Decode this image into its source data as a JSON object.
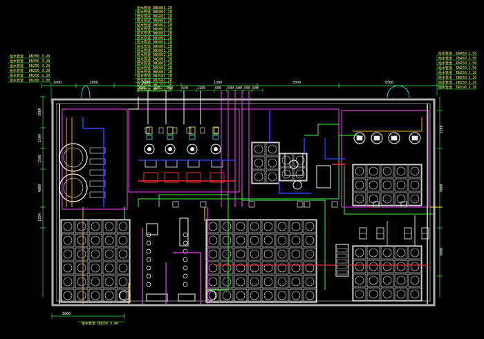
{
  "pipe_schedule_top": {
    "line_label": "给水管道",
    "rows": [
      {
        "size": "DN500",
        "elev": "2.20"
      },
      {
        "size": "DN500",
        "elev": "2.20"
      },
      {
        "size": "DN500",
        "elev": "2.20"
      },
      {
        "size": "DN500",
        "elev": "2.20"
      },
      {
        "size": "DN500",
        "elev": "2.20"
      },
      {
        "size": "DN500",
        "elev": "2.20"
      },
      {
        "size": "DN500",
        "elev": "2.20"
      },
      {
        "size": "DN500",
        "elev": "2.20"
      },
      {
        "size": "DN500",
        "elev": "2.20"
      },
      {
        "size": "DN500",
        "elev": "2.20"
      },
      {
        "size": "DN500",
        "elev": "2.20"
      },
      {
        "size": "DN500",
        "elev": "2.20"
      },
      {
        "size": "DN500",
        "elev": "2.20"
      },
      {
        "size": "DN500",
        "elev": "2.20"
      },
      {
        "size": "DN500",
        "elev": "2.20"
      },
      {
        "size": "DN500",
        "elev": "2.20"
      },
      {
        "size": "DN250",
        "elev": "2.20"
      },
      {
        "size": "DN250",
        "elev": "2.20"
      },
      {
        "size": "DN125",
        "elev": "2.20"
      },
      {
        "size": "DN125",
        "elev": "2.20"
      }
    ]
  },
  "pipe_schedule_left": {
    "line_label": "给水管道",
    "rows": [
      {
        "size": "DN350",
        "elev": "3.20"
      },
      {
        "size": "DN350",
        "elev": "3.20"
      },
      {
        "size": "DN250",
        "elev": "3.20"
      },
      {
        "size": "DN250",
        "elev": "3.20"
      },
      {
        "size": "DN250",
        "elev": "3.20"
      },
      {
        "size": "DN200",
        "elev": "1.00"
      }
    ]
  },
  "pipe_schedule_right": {
    "line_label": "给水管道",
    "rows": [
      {
        "size": "DN450",
        "elev": "2.50"
      },
      {
        "size": "DN450",
        "elev": "2.50"
      },
      {
        "size": "DN250",
        "elev": "2.50"
      },
      {
        "size": "DN250",
        "elev": "2.50"
      },
      {
        "size": "DN250",
        "elev": "3.20"
      },
      {
        "size": "DN250",
        "elev": "3.20"
      },
      {
        "size": "DN250",
        "elev": "3.20"
      },
      {
        "size": "DN200",
        "elev": "3.20"
      }
    ]
  },
  "dimensions_top_main": [
    "1000",
    "2000",
    "3000",
    "1300",
    "3000",
    "8500"
  ],
  "dimensions_top_sub": [
    "800",
    "640",
    "940",
    "640",
    "1100",
    "600",
    "500",
    "500",
    "500",
    "600"
  ],
  "dimensions_left": [
    "3000",
    "1500",
    "1500",
    "4000",
    "1500"
  ],
  "dimensions_right": [
    "1500",
    "4000",
    "3000"
  ],
  "dimension_bottom": "3000",
  "bottom_label": "给水管道 DN250  3.40",
  "colors": {
    "background": "#000000",
    "wall": "#b0b0b0",
    "magenta": "#ff40ff",
    "green": "#33ff33",
    "blue": "#2a4bff",
    "red": "#ff2a2a",
    "orange": "#ffaa33",
    "yellow": "#ffff44",
    "cyan": "#33ffff",
    "white": "#ffffff"
  }
}
